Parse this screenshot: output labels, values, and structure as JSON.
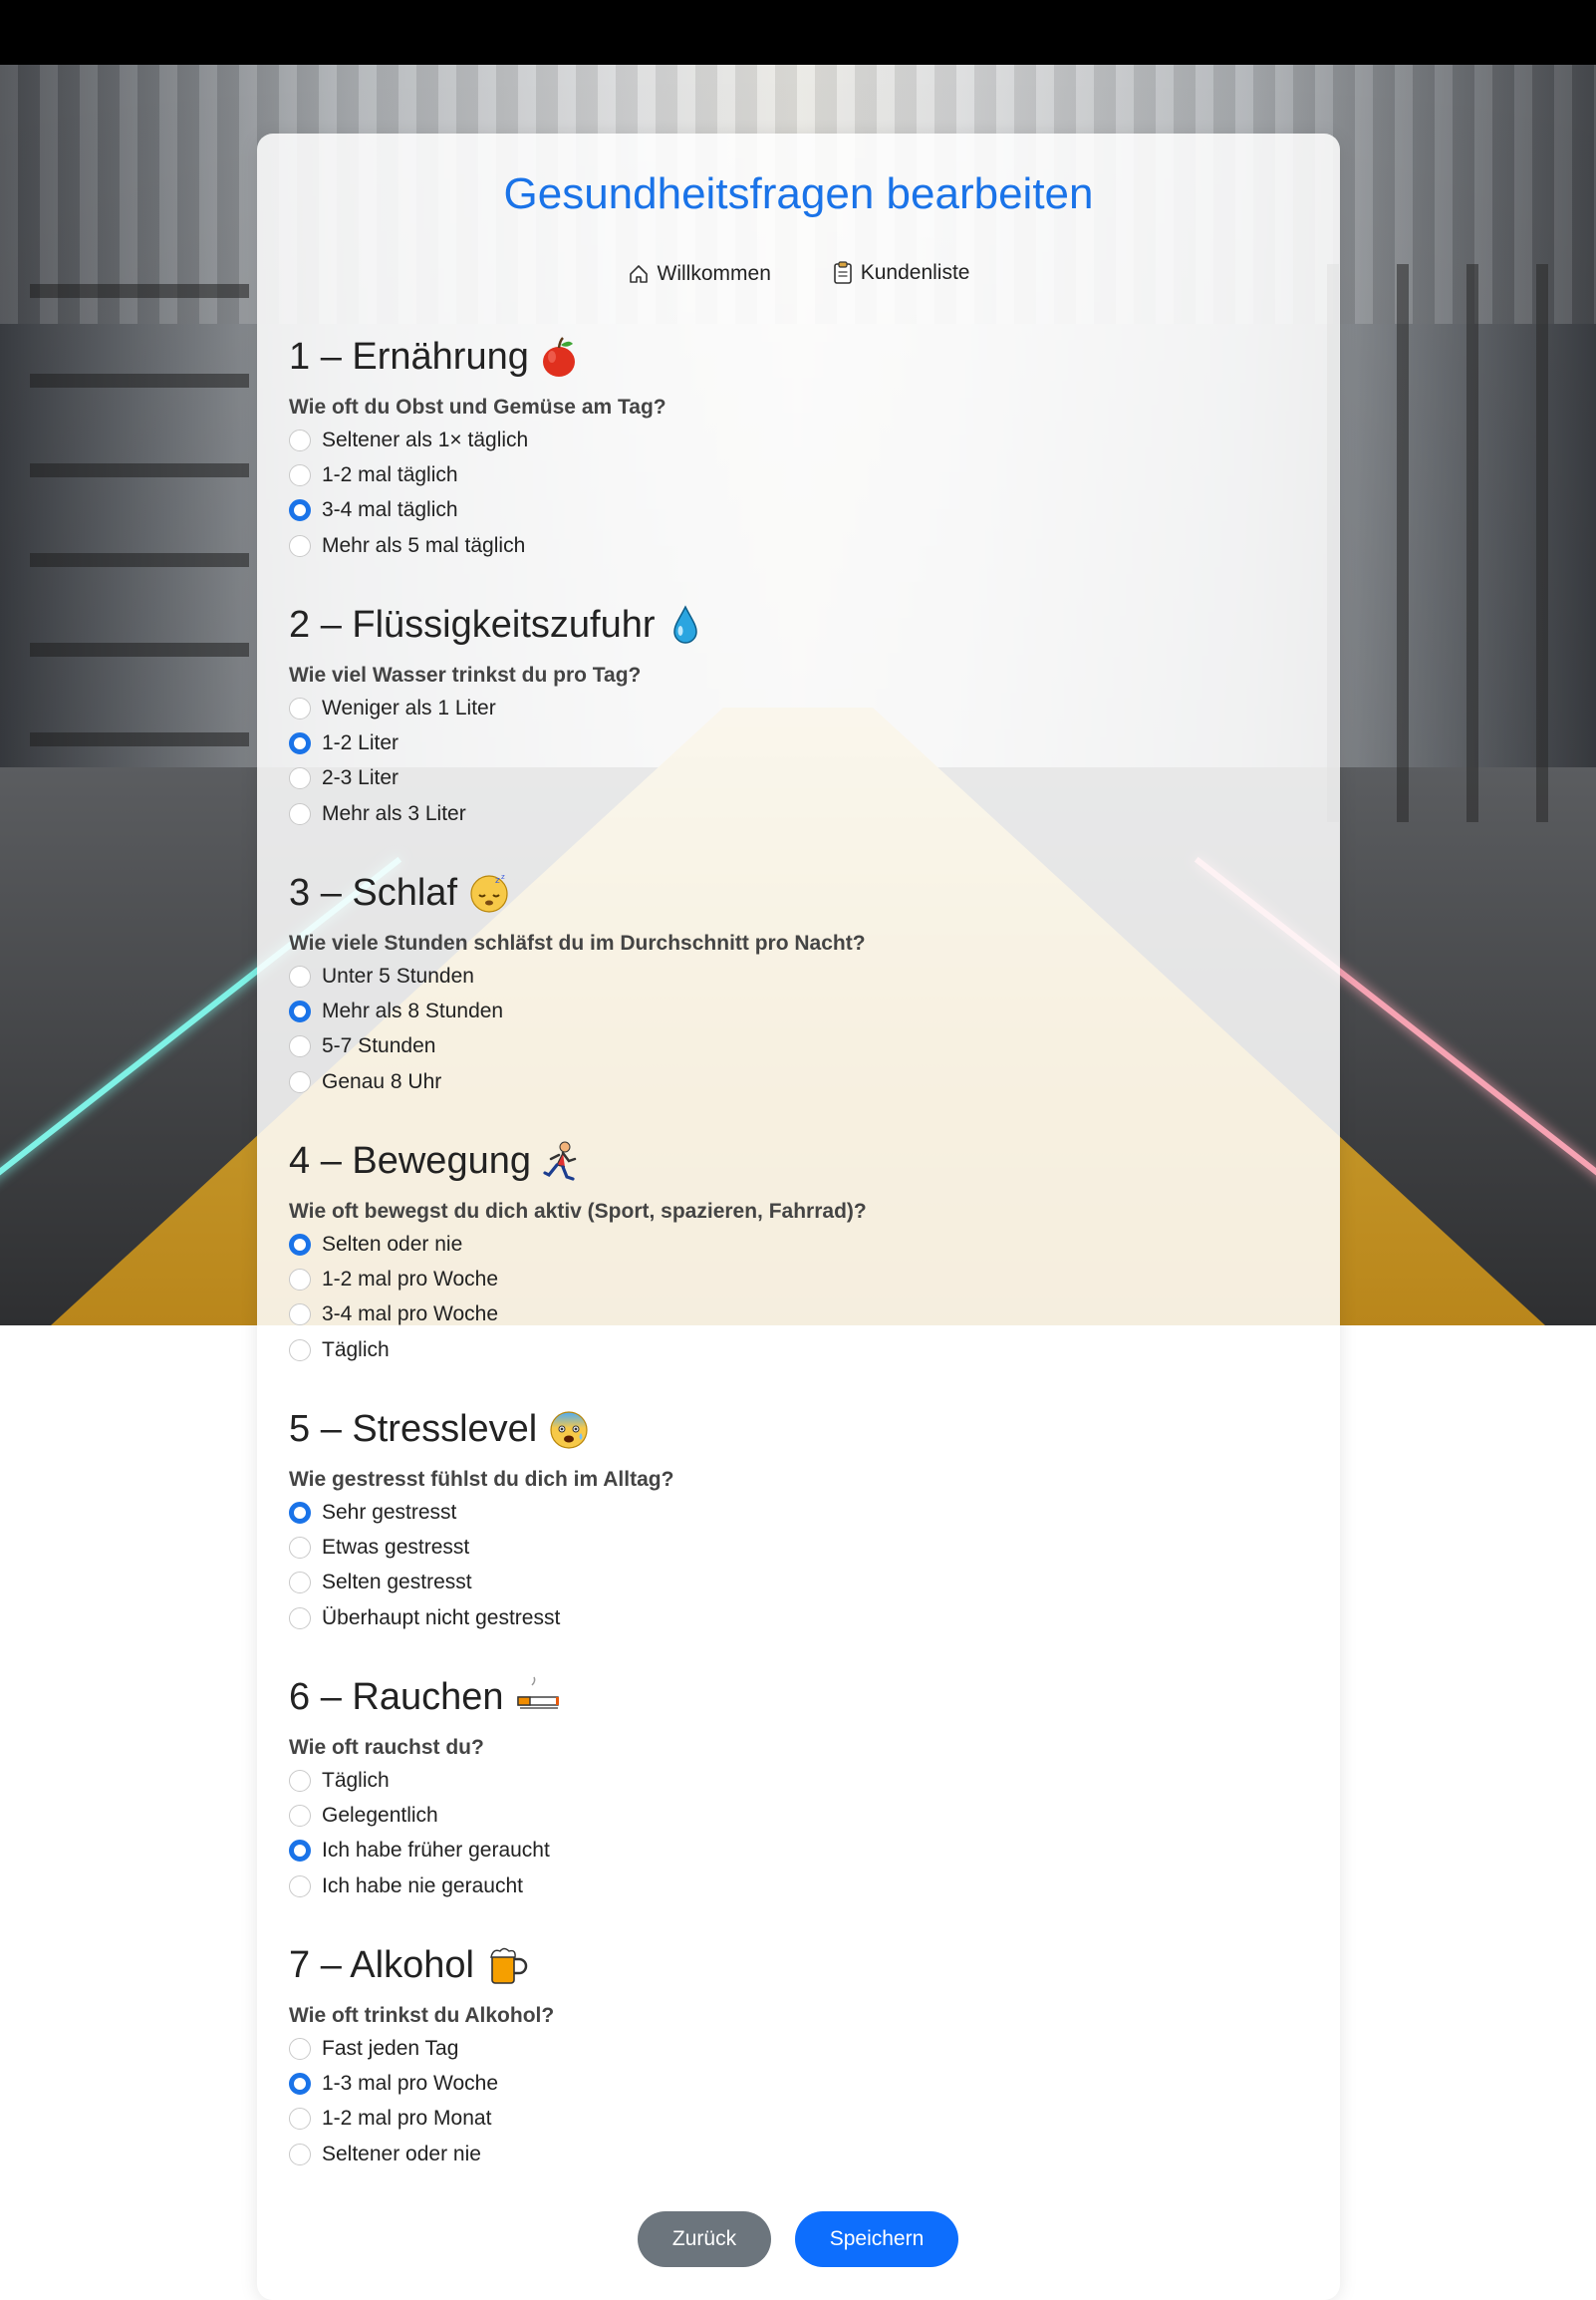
{
  "page": {
    "title": "Gesundheitsfragen bearbeiten"
  },
  "nav": [
    {
      "label": "Willkommen",
      "icon": "house-icon"
    },
    {
      "label": "Kundenliste",
      "icon": "clipboard-icon"
    }
  ],
  "sections": [
    {
      "heading": "1 – Ernährung",
      "icon": "red-apple-icon",
      "question": "Wie oft du Obst und Gemüse am Tag?",
      "options": [
        "Seltener als 1× täglich",
        "1-2 mal täglich",
        "3-4 mal täglich",
        "Mehr als 5 mal täglich"
      ],
      "selected_index": 2
    },
    {
      "heading": "2 – Flüssigkeitszufuhr",
      "icon": "droplet-icon",
      "question": "Wie viel Wasser trinkst du pro Tag?",
      "options": [
        "Weniger als 1 Liter",
        "1-2 Liter",
        "2-3 Liter",
        "Mehr als 3 Liter"
      ],
      "selected_index": 1
    },
    {
      "heading": "3 – Schlaf",
      "icon": "sleeping-face-icon",
      "question": "Wie viele Stunden schläfst du im Durchschnitt pro Nacht?",
      "options": [
        "Unter 5 Stunden",
        "Mehr als 8 Stunden",
        "5-7 Stunden",
        "Genau 8 Uhr"
      ],
      "selected_index": 1
    },
    {
      "heading": "4 – Bewegung",
      "icon": "running-person-icon",
      "question": "Wie oft bewegst du dich aktiv (Sport, spazieren, Fahrrad)?",
      "options": [
        "Selten oder nie",
        "1-2 mal pro Woche",
        "3-4 mal pro Woche",
        "Täglich"
      ],
      "selected_index": 0
    },
    {
      "heading": "5 – Stresslevel",
      "icon": "anxious-face-icon",
      "question": "Wie gestresst fühlst du dich im Alltag?",
      "options": [
        "Sehr gestresst",
        "Etwas gestresst",
        "Selten gestresst",
        "Überhaupt nicht gestresst"
      ],
      "selected_index": 0
    },
    {
      "heading": "6 – Rauchen",
      "icon": "cigarette-icon",
      "question": "Wie oft rauchst du?",
      "options": [
        "Täglich",
        "Gelegentlich",
        "Ich habe früher geraucht",
        "Ich habe nie geraucht"
      ],
      "selected_index": 2
    },
    {
      "heading": "7 – Alkohol",
      "icon": "beer-mug-icon",
      "question": "Wie oft trinkst du Alkohol?",
      "options": [
        "Fast jeden Tag",
        "1-3 mal pro Woche",
        "1-2 mal pro Monat",
        "Seltener oder nie"
      ],
      "selected_index": 1
    }
  ],
  "buttons": {
    "back_label": "Zurück",
    "save_label": "Speichern"
  },
  "colors": {
    "accent": "#1a73e8",
    "save_button": "#0d6efd",
    "back_button": "#6c757d"
  }
}
